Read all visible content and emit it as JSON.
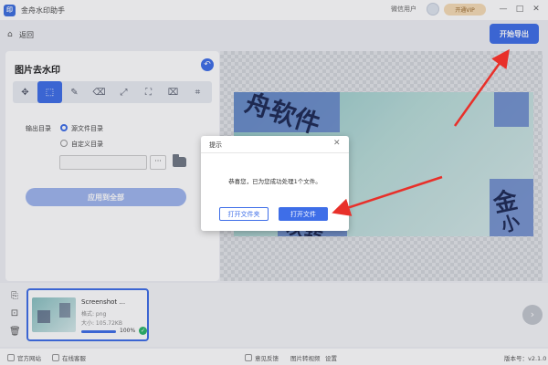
{
  "titlebar": {
    "app_logo": "印",
    "app_title": "金舟水印助手",
    "user_name": "微信用户",
    "vip_label": "开通VIP",
    "minimize": "—",
    "maximize": "□",
    "close": "✕"
  },
  "toolbar": {
    "back_label": "返回",
    "export_label": "开始导出"
  },
  "left_panel": {
    "title": "图片去水印",
    "tools": [
      {
        "icon": "move-icon",
        "glyph": "✥"
      },
      {
        "icon": "rect-select-icon",
        "glyph": "⬚"
      },
      {
        "icon": "brush-icon",
        "glyph": "✎"
      },
      {
        "icon": "eraser-icon",
        "glyph": "⌫"
      },
      {
        "icon": "expand-icon",
        "glyph": "⤢"
      },
      {
        "icon": "fullscreen-icon",
        "glyph": "⛶"
      },
      {
        "icon": "code-icon",
        "glyph": "⌧"
      },
      {
        "icon": "crop-icon",
        "glyph": "⌗"
      }
    ],
    "output_label": "输出目录",
    "option_source": "源文件目录",
    "option_custom": "自定义目录",
    "path_value": "",
    "more_label": "···",
    "apply_label": "应用到全部"
  },
  "canvas": {
    "watermark_text_1": "舟软件",
    "watermark_text_2": "金",
    "watermark_text_3": "小",
    "watermark_text_4": "次转"
  },
  "file": {
    "name": "Screenshot ...",
    "format": "格式: png",
    "size": "大小: 105.72KB",
    "progress_label": "100%",
    "progress_value": 1.0
  },
  "statusbar": {
    "official_site": "官方网站",
    "online_service": "在线客服",
    "feedback": "意见反馈",
    "video_tutorial": "图片转视频",
    "settings": "设置",
    "version": "版本号：v2.1.0"
  },
  "dialog": {
    "title": "提示",
    "message": "恭喜您，已为您成功处理1个文件。",
    "open_folder": "打开文件夹",
    "open_file": "打开文件"
  },
  "colors": {
    "accent": "#3e6ee8",
    "arrow": "#e8302a",
    "success": "#2bb56a"
  }
}
